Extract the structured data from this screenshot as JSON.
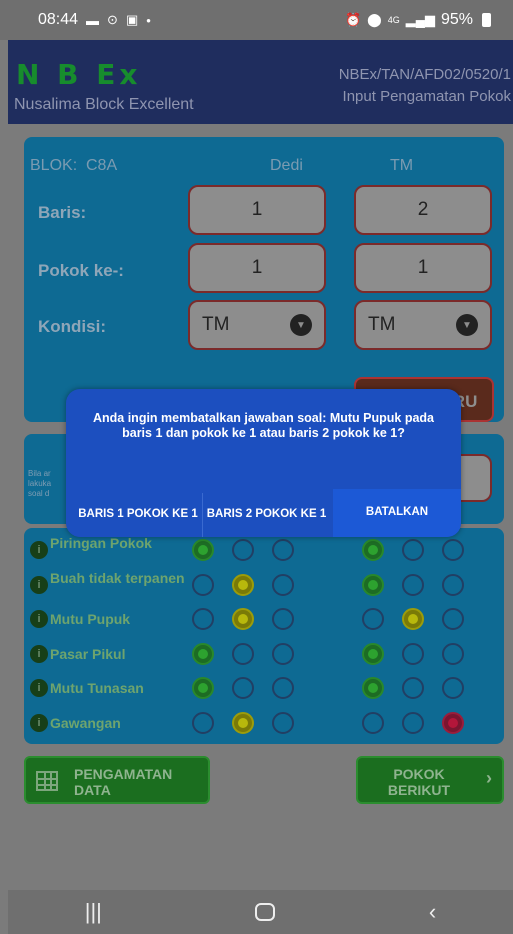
{
  "status_bar": {
    "time": "08:44",
    "battery": "95%",
    "network": "4G",
    "left_icons": [
      "message-icon",
      "location-icon",
      "briefcase-icon"
    ],
    "right_icons": [
      "alarm-icon",
      "location-icon",
      "signal-icon",
      "battery-icon"
    ]
  },
  "app_header": {
    "logo": "N B Ex",
    "subtitle": "Nusalima Block Excellent",
    "code": "NBEx/TAN/AFD02/0520/1",
    "screen_title": "Input Pengamatan Pokok"
  },
  "blok": {
    "label": "BLOK:",
    "value": "C8A",
    "mandor": "Dedi",
    "kind": "TM"
  },
  "form": {
    "baris_label": "Baris:",
    "baris_1": "1",
    "baris_2": "2",
    "pokok_label": "Pokok ke-:",
    "pokok_1": "1",
    "pokok_2": "1",
    "kondisi_label": "Kondisi:",
    "kondisi_1": "TM",
    "kondisi_2": "TM",
    "baris_baru_button": "BARIS BARU"
  },
  "hint": {
    "line1": "Bila ar",
    "line2": "lakuka",
    "line3": "soal d"
  },
  "questions": [
    {
      "label": "Piringan Pokok",
      "left": "green",
      "right": "green"
    },
    {
      "label": "Buah tidak terpanen",
      "left": "yellow",
      "right": "green"
    },
    {
      "label": "Mutu Pupuk",
      "left": "yellow",
      "right": "yellow"
    },
    {
      "label": "Pasar Pikul",
      "left": "green",
      "right": "green"
    },
    {
      "label": "Mutu Tunasan",
      "left": "green",
      "right": "green"
    },
    {
      "label": "Gawangan",
      "left": "yellow",
      "right": "red"
    }
  ],
  "footer": {
    "pengamatan_data": "PENGAMATAN DATA",
    "pokok_berikut": "POKOK BERIKUT"
  },
  "dialog": {
    "message": "Anda ingin membatalkan jawaban soal: Mutu Pupuk pada baris 1 dan pokok ke 1 atau baris 2 pokok ke 1?",
    "button_1": "BARIS 1 POKOK KE 1",
    "button_2": "BARIS 2 POKOK KE 1",
    "button_cancel": "BATALKAN"
  },
  "colors": {
    "header": "#1f2d5e",
    "panel": "#0e6a93",
    "dialog": "#1c4fbf",
    "green_button": "#1b6e1f"
  }
}
